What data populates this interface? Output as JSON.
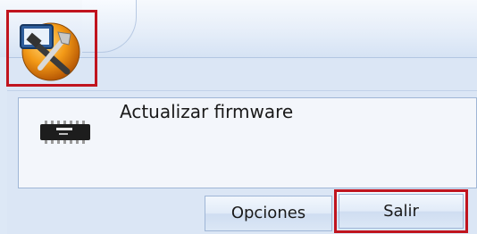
{
  "window": {
    "app_icon": "tools-icon"
  },
  "menu": {
    "items": [
      {
        "label": "Actualizar firmware",
        "icon": "chip-icon"
      }
    ]
  },
  "footer": {
    "options_label": "Opciones",
    "exit_label": "Salir"
  },
  "colors": {
    "highlight": "#c0141e",
    "panel": "#dbe6f5",
    "item_bg": "#f3f6fb"
  }
}
